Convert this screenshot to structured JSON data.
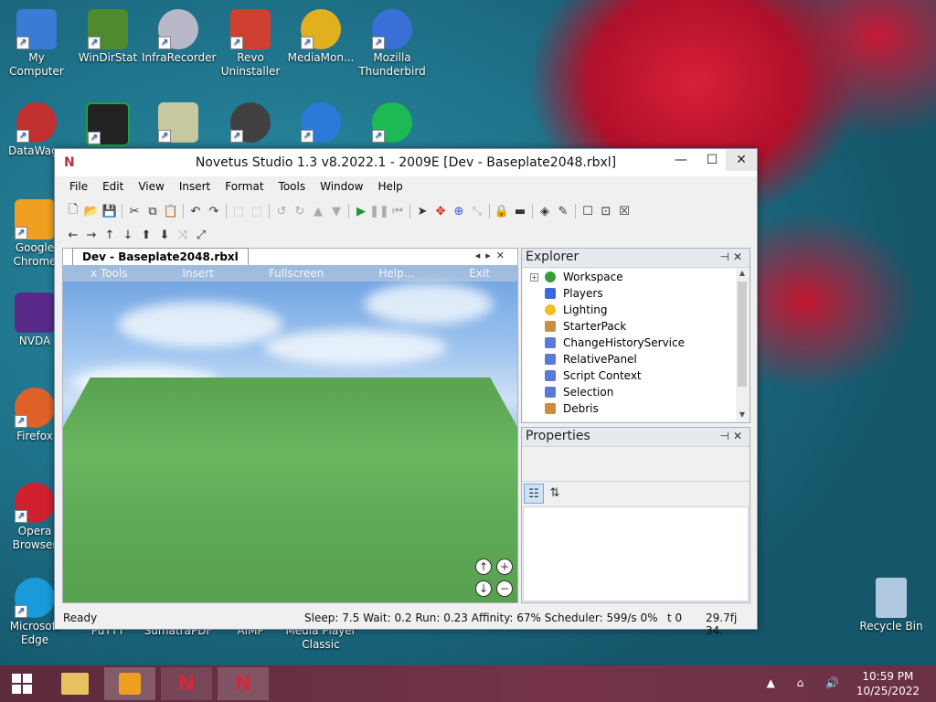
{
  "desktop": {
    "icons": [
      {
        "label": "My Computer",
        "icon": "monitor-icon",
        "color": "#3a7bd5"
      },
      {
        "label": "WinDirStat",
        "icon": "tree-icon",
        "color": "#4e8a2e"
      },
      {
        "label": "InfraRecorder",
        "icon": "disc-icon",
        "color": "#b8b8c8"
      },
      {
        "label": "Revo Uninstaller",
        "icon": "uninstall-icon",
        "color": "#d04030"
      },
      {
        "label": "MediaMon...",
        "icon": "media-icon",
        "color": "#e0b020"
      },
      {
        "label": "Mozilla Thunderbird",
        "icon": "thunderbird-icon",
        "color": "#3a6fd8"
      },
      {
        "label": "DataWago",
        "icon": "network-icon",
        "color": "#c03030"
      },
      {
        "label": "",
        "icon": "matrix-icon",
        "color": "#20a040"
      },
      {
        "label": "",
        "icon": "notepad-icon",
        "color": "#c8c8a0"
      },
      {
        "label": "",
        "icon": "steam-icon",
        "color": "#404040"
      },
      {
        "label": "",
        "icon": "moon-icon",
        "color": "#2a7ad8"
      },
      {
        "label": "",
        "icon": "spotify-icon",
        "color": "#1db954"
      },
      {
        "label": "Google Chrome",
        "icon": "chrome-icon",
        "color": "#f0a020"
      },
      {
        "label": "NVDA",
        "icon": "nvda-icon",
        "color": "#5a2a8a"
      },
      {
        "label": "Firefox",
        "icon": "firefox-icon",
        "color": "#e0602a"
      },
      {
        "label": "Opera Browser",
        "icon": "opera-icon",
        "color": "#d02030"
      },
      {
        "label": "Microsoft Edge",
        "icon": "edge-icon",
        "color": "#1a9ad8"
      },
      {
        "label": "PuTTY",
        "icon": "putty-icon",
        "color": "#888"
      },
      {
        "label": "SumatraPDF",
        "icon": "pdf-icon",
        "color": "#e0c020"
      },
      {
        "label": "AIMP",
        "icon": "aimp-icon",
        "color": "#e08020"
      },
      {
        "label": "Media Player Classic",
        "icon": "mpc-icon",
        "color": "#555"
      },
      {
        "label": "Recycle Bin",
        "icon": "recycle-bin-icon",
        "color": "#b0c8e0"
      }
    ]
  },
  "window": {
    "title": "Novetus Studio 1.3 v8.2022.1 - 2009E [Dev - Baseplate2048.rbxl]",
    "logo": "N",
    "minimize": "—",
    "maximize": "☐",
    "close": "✕",
    "menu": [
      "File",
      "Edit",
      "View",
      "Insert",
      "Format",
      "Tools",
      "Window",
      "Help"
    ],
    "doc_tab": "Dev - Baseplate2048.rbxl",
    "viewport_menu": [
      "x Tools",
      "Insert",
      "Fullscreen",
      "Help...",
      "Exit"
    ],
    "explorer": {
      "title": "Explorer",
      "items": [
        {
          "label": "Workspace",
          "icon": "globe-icon",
          "color": "#3a9a3a",
          "expand": "+"
        },
        {
          "label": "Players",
          "icon": "players-icon",
          "color": "#3a6ad8"
        },
        {
          "label": "Lighting",
          "icon": "bulb-icon",
          "color": "#f0c020"
        },
        {
          "label": "StarterPack",
          "icon": "pack-icon",
          "color": "#c89040"
        },
        {
          "label": "ChangeHistoryService",
          "icon": "service-icon",
          "color": "#5a7ad8"
        },
        {
          "label": "RelativePanel",
          "icon": "service-icon",
          "color": "#5a7ad8"
        },
        {
          "label": "Script Context",
          "icon": "service-icon",
          "color": "#5a7ad8"
        },
        {
          "label": "Selection",
          "icon": "service-icon",
          "color": "#5a7ad8"
        },
        {
          "label": "Debris",
          "icon": "debris-icon",
          "color": "#c89040"
        }
      ]
    },
    "properties": {
      "title": "Properties"
    },
    "status": {
      "left": "Ready",
      "middle": "Sleep: 7.5 Wait: 0.2 Run: 0.23 Affinity: 67% Scheduler: 599/s 0%",
      "t": "t 0",
      "fps": "29.7fj 34."
    }
  },
  "taskbar": {
    "time": "10:59 PM",
    "date": "10/25/2022",
    "tray": "▲ ⌂ 🔊"
  }
}
